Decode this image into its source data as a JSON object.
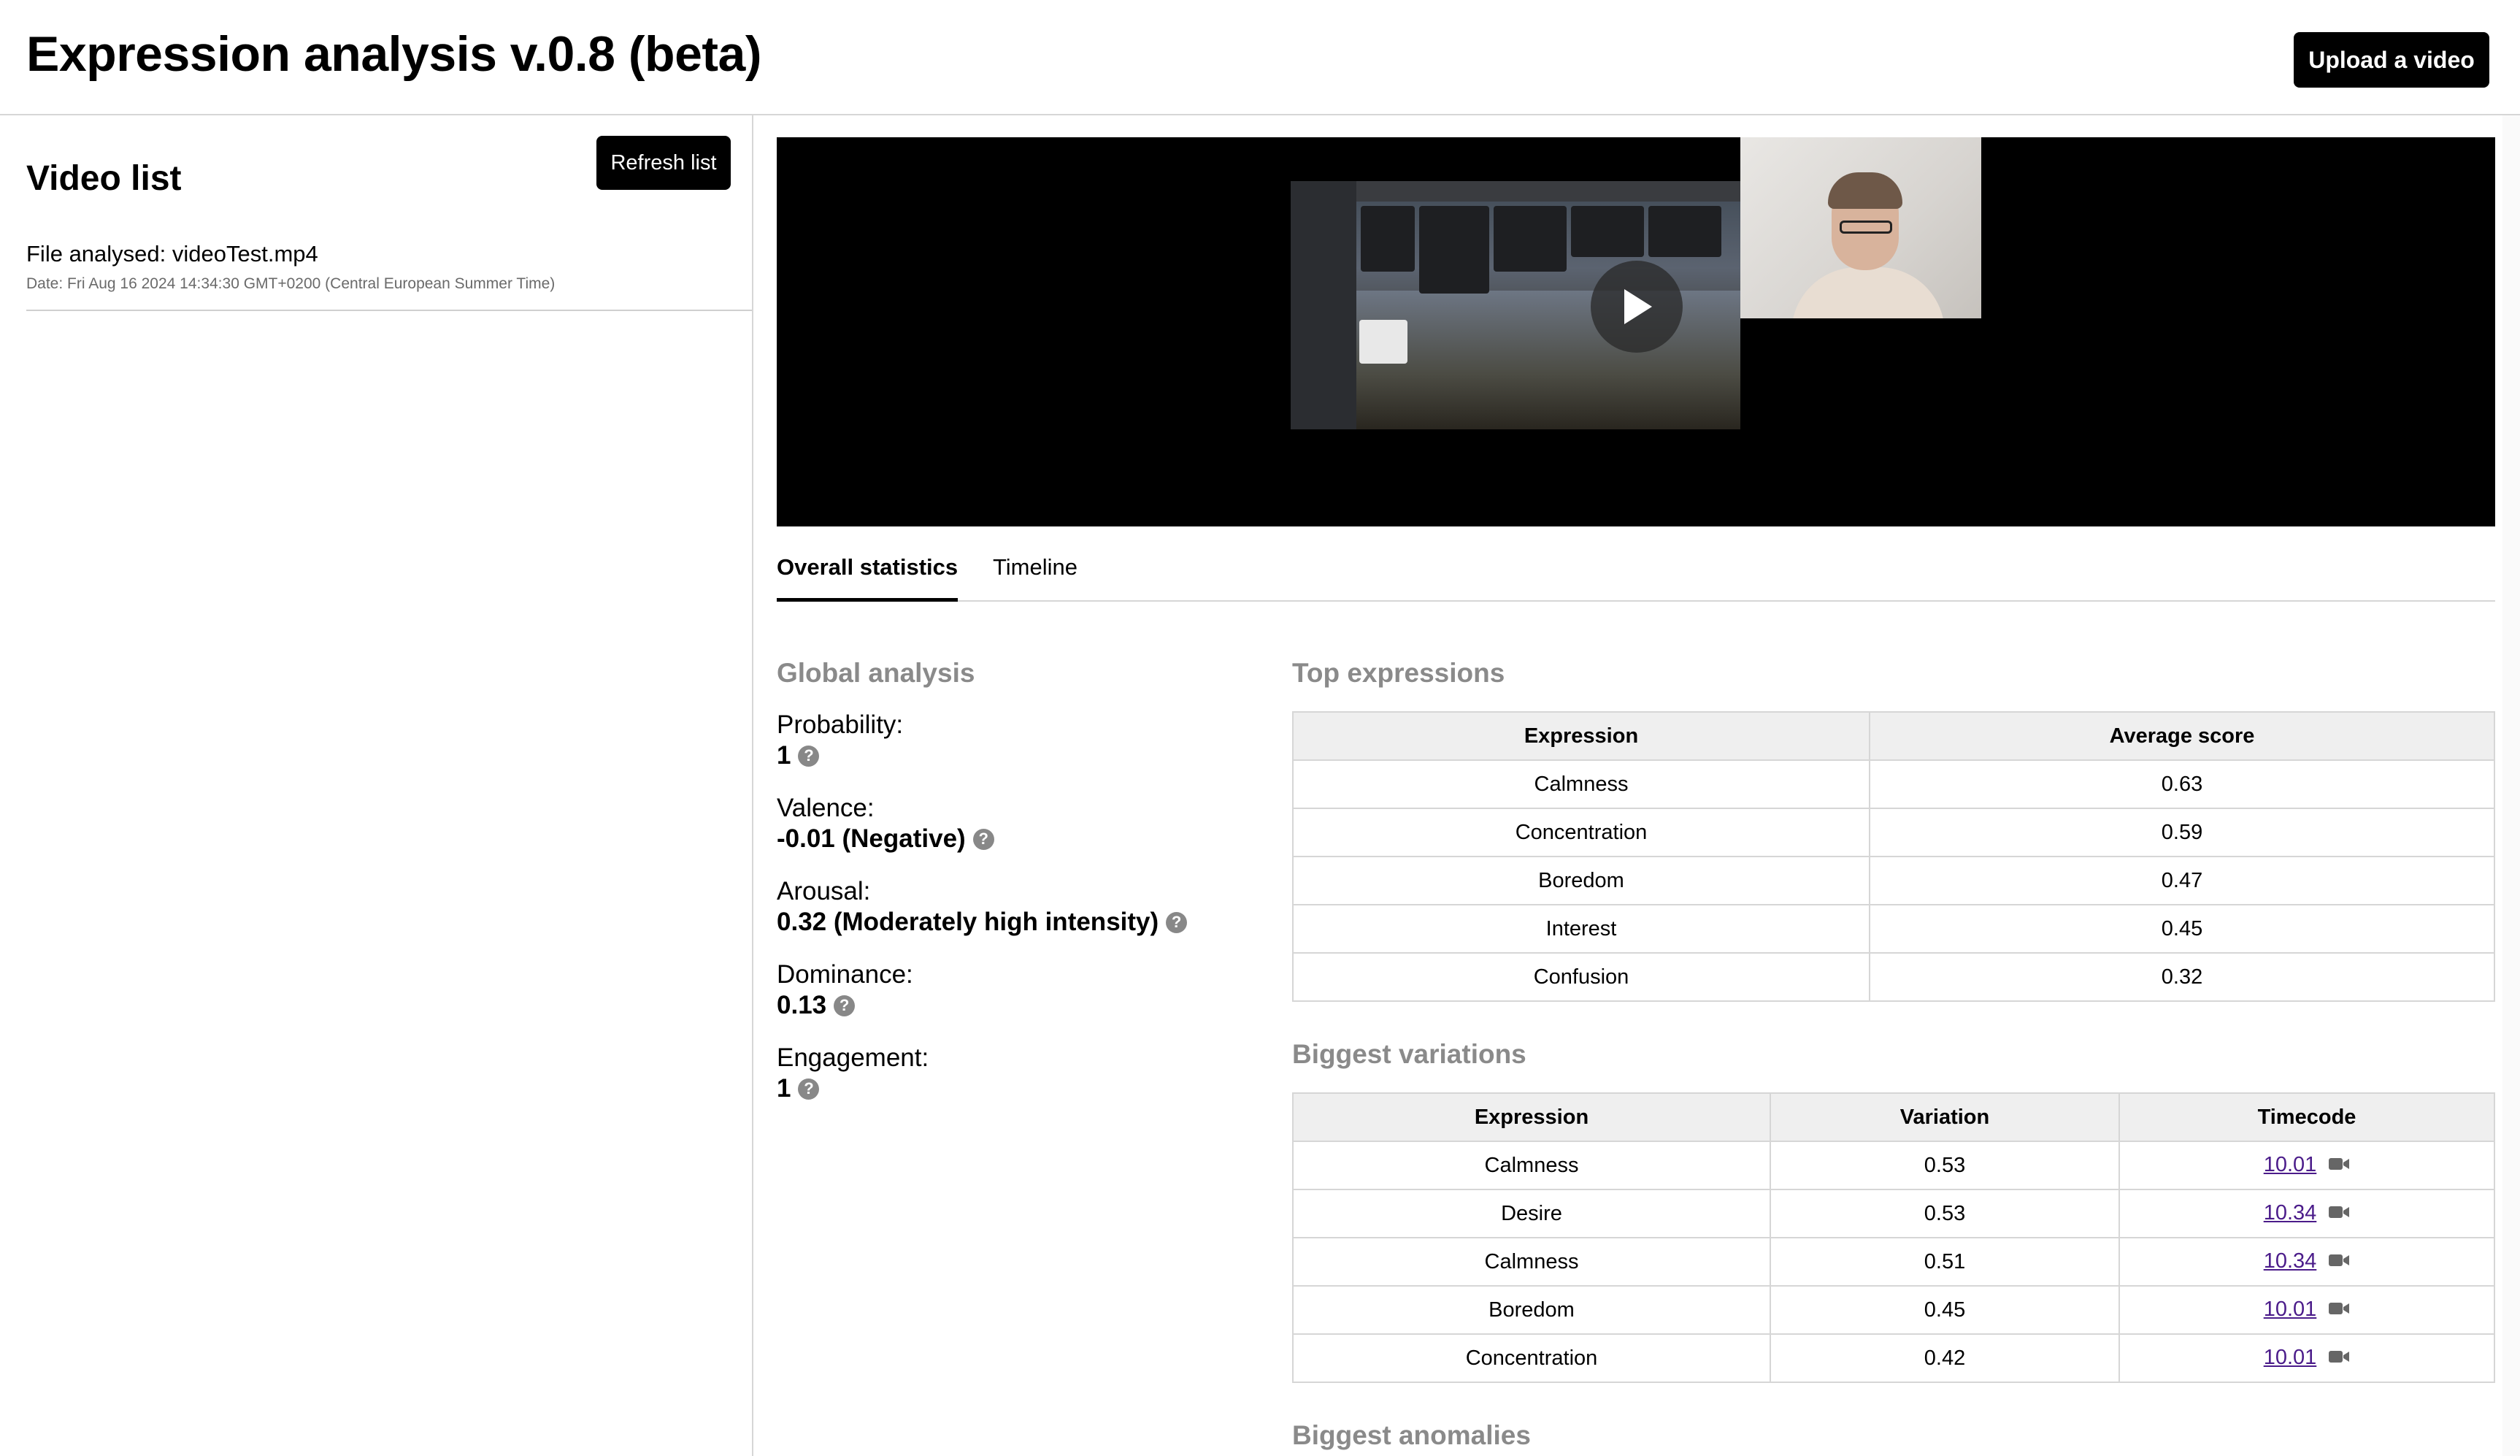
{
  "header": {
    "title": "Expression analysis v.0.8 (beta)",
    "upload_label": "Upload a video"
  },
  "sidebar": {
    "title": "Video list",
    "refresh_label": "Refresh list",
    "items": [
      {
        "file": "File analysed: videoTest.mp4",
        "date": "Date: Fri Aug 16 2024 14:34:30 GMT+0200 (Central European Summer Time)"
      }
    ]
  },
  "tabs": [
    "Overall statistics",
    "Timeline"
  ],
  "global": {
    "title": "Global analysis",
    "stats": [
      {
        "label": "Probability:",
        "value": "1"
      },
      {
        "label": "Valence:",
        "value": "-0.01 (Negative)"
      },
      {
        "label": "Arousal:",
        "value": "0.32 (Moderately high intensity)"
      },
      {
        "label": "Dominance:",
        "value": "0.13"
      },
      {
        "label": "Engagement:",
        "value": "1"
      }
    ],
    "help_glyph": "?"
  },
  "top_expressions": {
    "title": "Top expressions",
    "headers": [
      "Expression",
      "Average score"
    ],
    "rows": [
      [
        "Calmness",
        "0.63"
      ],
      [
        "Concentration",
        "0.59"
      ],
      [
        "Boredom",
        "0.47"
      ],
      [
        "Interest",
        "0.45"
      ],
      [
        "Confusion",
        "0.32"
      ]
    ]
  },
  "biggest_variations": {
    "title": "Biggest variations",
    "headers": [
      "Expression",
      "Variation",
      "Timecode"
    ],
    "rows": [
      [
        "Calmness",
        "0.53",
        "10.01"
      ],
      [
        "Desire",
        "0.53",
        "10.34"
      ],
      [
        "Calmness",
        "0.51",
        "10.34"
      ],
      [
        "Boredom",
        "0.45",
        "10.01"
      ],
      [
        "Concentration",
        "0.42",
        "10.01"
      ]
    ]
  },
  "biggest_anomalies": {
    "title": "Biggest anomalies"
  },
  "icons": {
    "play": "play-icon",
    "help": "question-circle-icon",
    "camera": "video-camera-icon"
  },
  "colors": {
    "link": "#4b1c8a",
    "section_title": "#8a8a8a"
  }
}
